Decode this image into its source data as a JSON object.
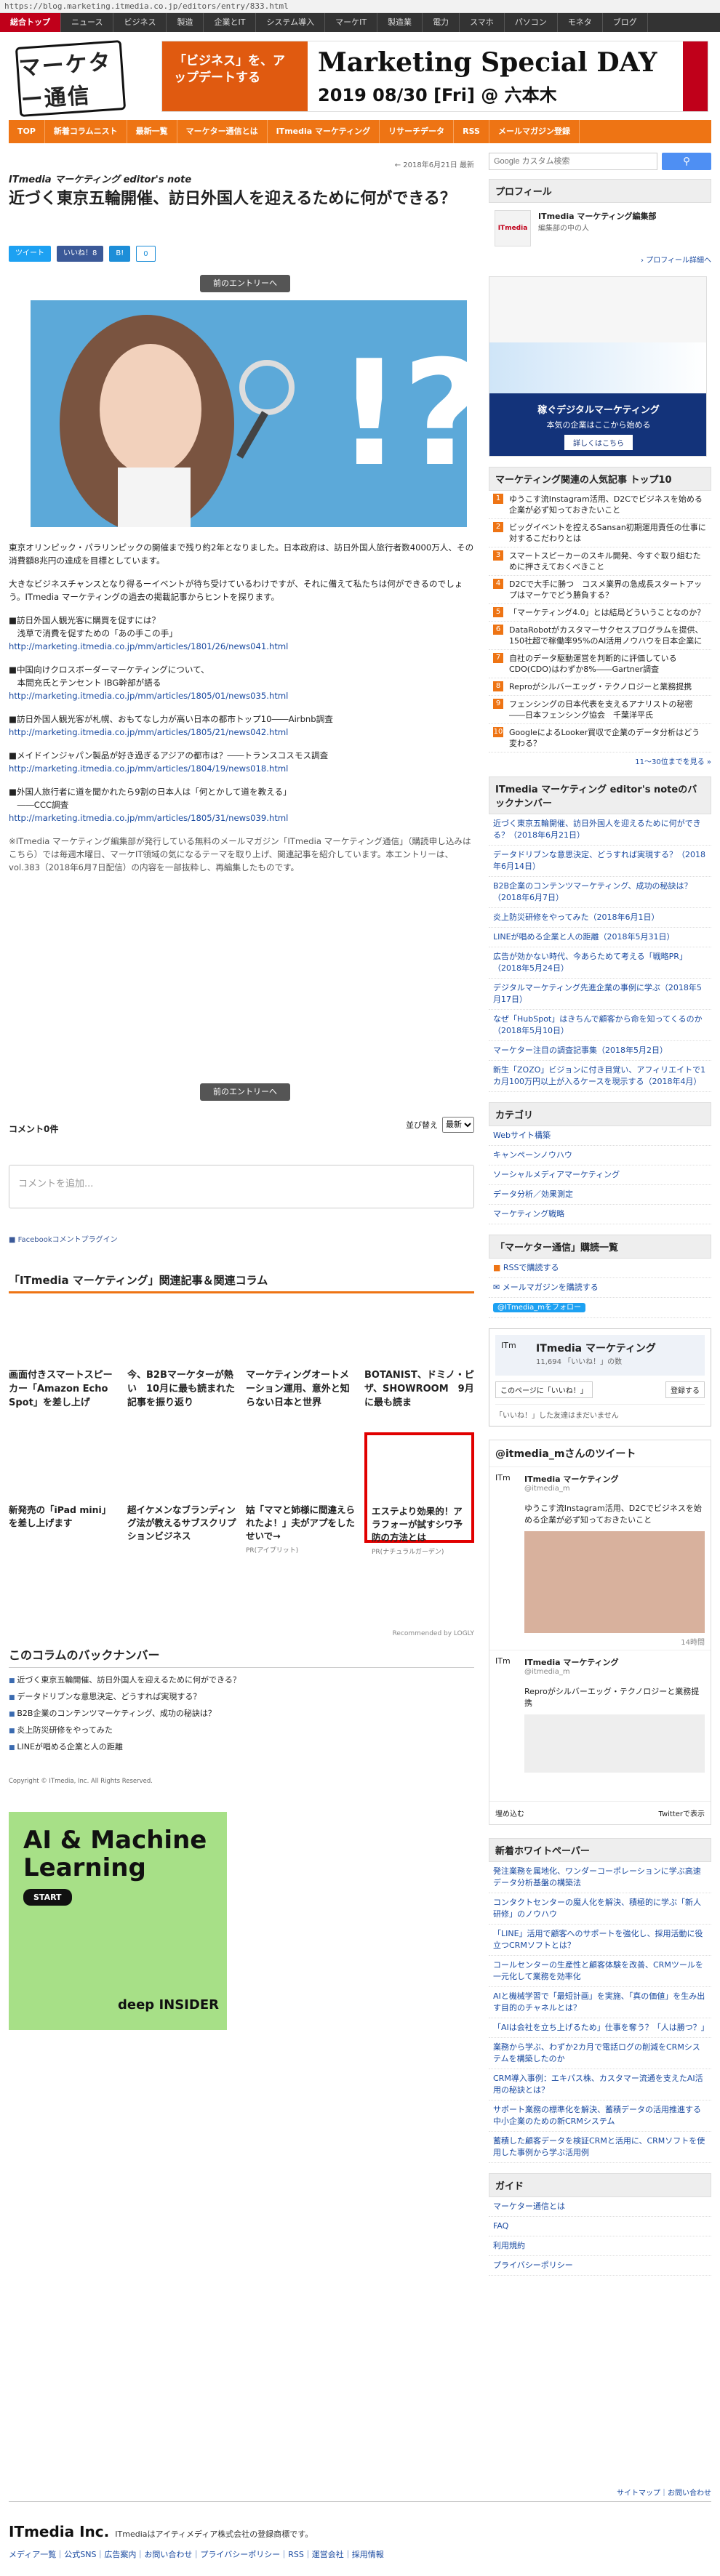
{
  "url": "https://blog.marketing.itmedia.co.jp/editors/entry/833.html",
  "gnav": [
    "総合トップ",
    "ニュース",
    "ビジネス",
    "製造",
    "企業とIT",
    "システム導入",
    "マーケIT",
    "製造業",
    "電力",
    "スマホ",
    "パソコン",
    "モネタ",
    "ブログ"
  ],
  "logo": "マーケター通信",
  "banner": {
    "left": "「ビジネス」を、アップデートする",
    "title": "Marketing Special DAY",
    "date": "2019 08/30 [Fri] @ 六本木"
  },
  "onav": [
    "TOP",
    "新着コラムニスト",
    "最新一覧",
    "マーケター通信とは",
    "ITmedia マーケティング",
    "リサーチデータ",
    "RSS",
    "メールマガジン登録"
  ],
  "article": {
    "date": "← 2018年6月21日 最新",
    "series": "ITmedia マーケティング editor's note",
    "title": "近づく東京五輪開催、訪日外国人を迎えるために何ができる？",
    "share": [
      "ツイート",
      "いいね！8",
      "B!",
      "0"
    ],
    "prev": "前のエントリーへ",
    "p1": "東京オリンピック・パラリンピックの開催まで残り約2年となりました。日本政府は、訪日外国人旅行者数4000万人、その消費額8兆円の達成を目標としています。",
    "p2": "大きなビジネスチャンスとなり得るーイベントが待ち受けているわけですが、それに備えて私たちは何ができるのでしょう。ITmedia マーケティングの過去の掲載記事からヒントを探ります。",
    "links": [
      {
        "title": "■訪日外国人観光客に購買を促すには？\n　浅草で消費を促すための「あの手この手」",
        "url": "http://marketing.itmedia.co.jp/mm/articles/1801/26/news041.html"
      },
      {
        "title": "■中国向けクロスボーダーマーケティングについて、\n　本間充氏とテンセント IBG幹部が語る",
        "url": "http://marketing.itmedia.co.jp/mm/articles/1805/01/news035.html"
      },
      {
        "title": "■訪日外国人観光客が札幌、おもてなし力が高い日本の都市トップ10――Airbnb調査",
        "url": "http://marketing.itmedia.co.jp/mm/articles/1805/21/news042.html"
      },
      {
        "title": "■メイドインジャパン製品が好き過ぎるアジアの都市は？――トランスコスモス調査",
        "url": "http://marketing.itmedia.co.jp/mm/articles/1804/19/news018.html"
      },
      {
        "title": "■外国人旅行者に道を聞かれたら9割の日本人は「何とかして道を教える」\n　――CCC調査",
        "url": "http://marketing.itmedia.co.jp/mm/articles/1805/31/news039.html"
      }
    ],
    "note": "※ITmedia マーケティング編集部が発行している無料のメールマガジン「ITmedia マーケティング通信」（購読申し込みはこちら）では毎週木曜日、マーケIT領域の気になるテーマを取り上げ、関連記事を紹介しています。本エントリーは、vol.383（2018年6月7日配信）の内容を一部抜粋し、再編集したものです。",
    "next": "前のエントリーへ"
  },
  "comments": {
    "count": "コメント0件",
    "sort_label": "並び替え",
    "sort_value": "最新",
    "placeholder": "コメントを追加...",
    "plugin": "Facebookコメントプラグイン"
  },
  "related": {
    "heading": "「ITmedia マーケティング」関連記事＆関連コラム",
    "row1": [
      "画面付きスマートスピーカー「Amazon Echo Spot」を差し上げ",
      "今、B2Bマーケターが熱い　10月に最も読まれた記事を振り返り",
      "マーケティングオートメーション運用、意外と知らない日本と世界",
      "BOTANIST、ドミノ・ピザ、SHOWROOM　9月に最も読ま"
    ],
    "row2": [
      "新発売の「iPad mini」を差し上げます",
      "超イケメンなブランディング法が教えるサブスクリプションビジネス",
      "姑「ママと姉様に間違えられたよ！」夫がアプをしたせいで→",
      "エステより効果的！アラフォーが試すシワ予防の方法とは"
    ],
    "row2_sub": [
      "",
      "",
      "PR(アイプリット)",
      "PR(ナチュラルガーデン)"
    ],
    "reco": "Recommended by LOGLY"
  },
  "backnumber": {
    "heading": "このコラムのバックナンバー",
    "items": [
      "近づく東京五輪開催、訪日外国人を迎えるために何ができる？",
      "データドリブンな意思決定、どうすれば実現する？",
      "B2B企業のコンテンツマーケティング、成功の秘訣は？",
      "炎上防災研修をやってみた",
      "LINEが唱める企業と人の距離"
    ]
  },
  "copyright": "Copyright © ITmedia, Inc. All Rights Reserved.",
  "aiad": {
    "title": "AI & Machine Learning",
    "cta": "START",
    "brand": "deep INSIDER"
  },
  "side": {
    "search_placeholder": "Google カスタム検索",
    "profile_h": "プロフィール",
    "profile_name": "ITmedia マーケティング編集部",
    "profile_desc": "編集部の中の人",
    "profile_more": "› プロフィール詳細へ",
    "ad_title": "稼ぐデジタルマーケティング",
    "ad_sub": "本気の企業はここから始める",
    "ad_cta": "詳しくはこちら",
    "rank_h": "マーケティング関連の人気記事 トップ10",
    "rank": [
      "ゆうこす流Instagram活用、D2Cでビジネスを始める企業が必ず知っておきたいこと",
      "ビッグイベントを控えるSansan初期運用責任の仕事に対するこだわりとは",
      "スマートスピーカーのスキル開発、今すぐ取り組むために押さえておくべきこと",
      "D2Cで大手に勝つ　コスメ業界の急成長スタートアップはマーケでどう勝負する？",
      "「マーケティング4.0」とは結局どういうことなのか？",
      "DataRobotがカスタマーサクセスプログラムを提供、150社超で稼働率95%のAI活用ノウハウを日本企業に",
      "自社のデータ駆動運営を判断的に評価しているCDO(CDO)はわずか8%――Gartner調査",
      "Reproがシルバーエッグ・テクノロジーと業務提携",
      "フェンシングの日本代表を支えるアナリストの秘密――日本フェンシング協会　千葉洋平氏",
      "GoogleによるLooker買収で企業のデータ分析はどう変わる？"
    ],
    "rank_more": "11～30位までを見る »",
    "editor_h": "ITmedia マーケティング editor's noteのバックナンバー",
    "editor": [
      "近づく東京五輪開催、訪日外国人を迎えるために何ができる？（2018年6月21日）",
      "データドリブンな意思決定、どうすれば実現する？（2018年6月14日）",
      "B2B企業のコンテンツマーケティング、成功の秘訣は？（2018年6月7日）",
      "炎上防災研修をやってみた（2018年6月1日）",
      "LINEが唱める企業と人の距離（2018年5月31日）",
      "広告が効かない時代、今あらためて考える「戦略PR」（2018年5月24日）",
      "デジタルマーケティング先進企業の事例に学ぶ（2018年5月17日）",
      "なぜ「HubSpot」はきちんで顧客から命を知ってくるのか（2018年5月10日）",
      "マーケター注目の調査記事集（2018年5月2日）",
      "新生「ZOZO」ビジョンに付き目覚い、アフィリエイトで1カ月100万円以上が入るケースを現示する（2018年4月）"
    ],
    "cat_h": "カテゴリ",
    "cats": [
      "Webサイト構築",
      "キャンペーンノウハウ",
      "ソーシャルメディアマーケティング",
      "データ分析／効果測定",
      "マーケティング戦略"
    ],
    "mail_h": "「マーケター通信」購読一覧",
    "mail": [
      "RSSで購読する",
      "メールマガジンを購読する",
      "@ITmedia_mをフォロー"
    ],
    "fb_name": "ITmedia マーケティング",
    "fb_likes": "11,694 「いいね！」の数",
    "fb_like": "このページに「いいね！」",
    "fb_share": "登録する",
    "fb_note": "「いいね！」した友達はまだいません",
    "tw_h": "@itmedia_mさんのツイート",
    "tw_name": "ITmedia マーケティング",
    "tw_handle": "@itmedia_m",
    "tw_text1": "ゆうこす流Instagram活用、D2Cでビジネスを始める企業が必ず知っておきたいこと",
    "tw_time": "14時間",
    "tw_text2": "Reproがシルバーエッグ・テクノロジーと業務提携",
    "tw_embed": "埋め込む",
    "tw_view": "Twitterで表示",
    "wp_h": "新着ホワイトペーパー",
    "wp": [
      "発注業務を属地化、ワンダーコーポレーションに学ぶ高速データ分析基盤の構築法",
      "コンタクトセンターの魔人化を解決、積極的に学ぶ「新人研修」のノウハウ",
      "「LINE」活用で顧客へのサポートを強化し、採用活動に役立つCRMソフトとは？",
      "コールセンターの生産性と顧客体験を改善、CRMツールを一元化して業務を効率化",
      "AIと機械学習で「最短計画」を実施、「真の価値」を生み出す目的のチャネルとは？",
      "「AIは会社を立ち上げるため」仕事を奪う？「人は勝つ？」",
      "業務から学ぶ、わずか2カ月で電話ログの削減をCRMシステムを構築したのか",
      "CRM導入事例：エキパス株、カスタマー流通を支えたAI活用の秘訣とは？",
      "サポート業務の標準化を解決、蓄積データの活用推進する中小企業のための新CRMシステム",
      "蓄積した顧客データを検証CRMと活用に、CRMソフトを使用した事例から学ぶ活用例"
    ],
    "guide_h": "ガイド",
    "guide": [
      "マーケター通信とは",
      "FAQ",
      "利用規約",
      "プライバシーポリシー"
    ]
  },
  "footer": {
    "top_links": "サイトマップ｜お問い合わせ",
    "company": "ITmedia Inc.",
    "company_desc": "ITmediaはアイティメディア株式会社の登録商標です。",
    "links": "メディア一覧｜公式SNS｜広告案内｜お問い合わせ｜プライバシーポリシー｜RSS｜運営会社｜採用情報"
  },
  "colors": {
    "accent": "#ee7414",
    "brand_red": "#c0001a",
    "twitter": "#1da1f2",
    "facebook": "#3b5998"
  }
}
